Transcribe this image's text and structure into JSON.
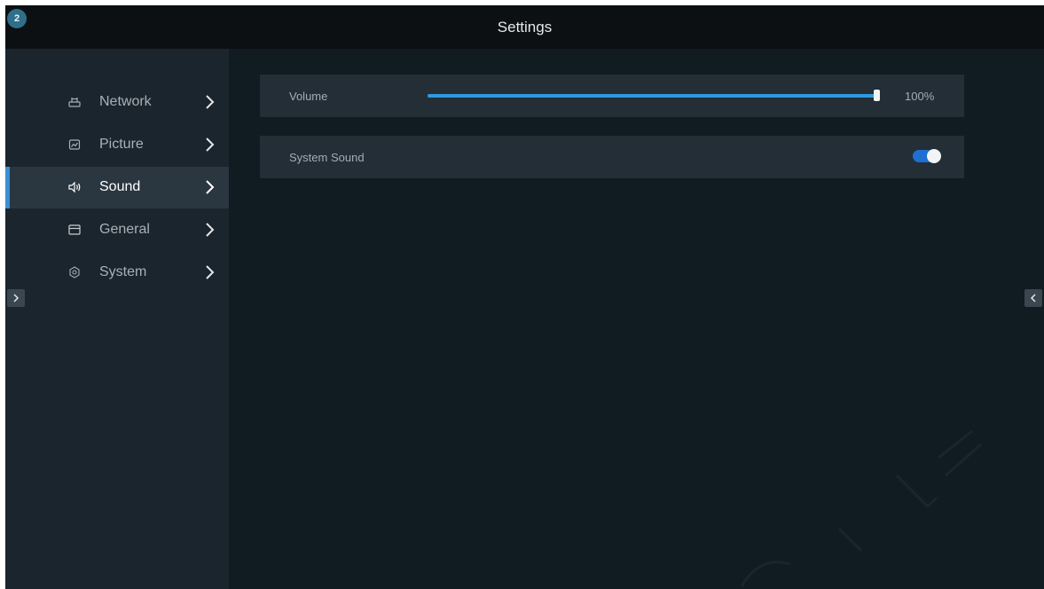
{
  "window": {
    "badge": "2",
    "title": "Settings"
  },
  "sidebar": {
    "items": [
      {
        "label": "Network",
        "icon": "network-icon"
      },
      {
        "label": "Picture",
        "icon": "picture-icon"
      },
      {
        "label": "Sound",
        "icon": "speaker-icon",
        "active": true
      },
      {
        "label": "General",
        "icon": "general-icon"
      },
      {
        "label": "System",
        "icon": "gear-icon"
      }
    ]
  },
  "sound": {
    "volume": {
      "label": "Volume",
      "value": 100,
      "value_text": "100%"
    },
    "system_sound": {
      "label": "System Sound",
      "enabled": true
    }
  },
  "colors": {
    "accent": "#3a8fd6",
    "slider_fill": "#2f9ae0",
    "toggle_on": "#1e6fd0"
  }
}
